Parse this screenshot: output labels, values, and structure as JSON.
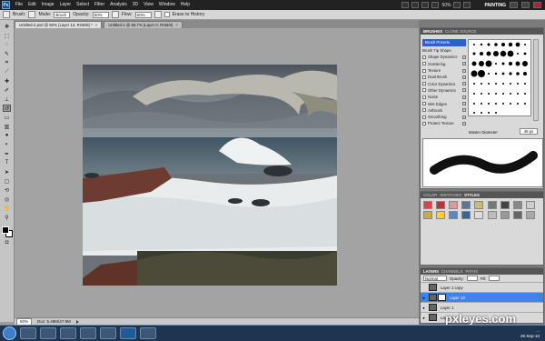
{
  "app": {
    "logo": "Ps",
    "workspace": "PAINTING",
    "zoom": "50%"
  },
  "menu": [
    "File",
    "Edit",
    "Image",
    "Layer",
    "Select",
    "Filter",
    "Analysis",
    "3D",
    "View",
    "Window",
    "Help"
  ],
  "options": {
    "brush_label": "Brush:",
    "mode_label": "Mode:",
    "mode_value": "Brush",
    "opacity_label": "Opacity:",
    "opacity_value": "50%",
    "flow_label": "Flow:",
    "flow_value": "60%",
    "erase_history": "Erase to History"
  },
  "tabs": [
    {
      "title": "Untitled-2.psd @ 50% (Layer 13, RGB/8) *",
      "close": "×"
    },
    {
      "title": "Untitled-1 @ 66.7% (Layer 0, RGB/8)",
      "close": "×"
    }
  ],
  "status": {
    "zoom": "50%",
    "doc": "Doc: 5.49M/47.9M"
  },
  "brushes": {
    "tabs": [
      "BRUSHES",
      "CLONE SOURCE"
    ],
    "preset_label": "Brush Presets",
    "options": [
      "Brush Tip Shape",
      "Shape Dynamics",
      "Scattering",
      "Texture",
      "Dual Brush",
      "Color Dynamics",
      "Other Dynamics",
      "Noise",
      "Wet Edges",
      "Airbrush",
      "Smoothing",
      "Protect Texture"
    ],
    "diameter_label": "Master Diameter",
    "diameter_value": "45 px"
  },
  "styles_tabs": [
    "COLOR",
    "SWATCHES",
    "STYLES"
  ],
  "style_colors": [
    "#d44",
    "#b33",
    "#d99",
    "#579",
    "#cb7",
    "#777",
    "#444",
    "#888",
    "#ccc",
    "#ca4",
    "#fc3",
    "#58c",
    "#369",
    "#ddd",
    "#bbb",
    "#999",
    "#666",
    "#aaa"
  ],
  "layers": {
    "tabs": [
      "LAYERS",
      "CHANNELS",
      "PATHS"
    ],
    "blend_mode": "Normal",
    "opacity_label": "Opacity:",
    "fill_label": "Fill:",
    "rows": [
      {
        "name": "Layer 1 copy",
        "visible": false,
        "active": false
      },
      {
        "name": "Layer 13",
        "visible": true,
        "active": true
      },
      {
        "name": "Layer 1",
        "visible": true,
        "active": false
      },
      {
        "name": "Layer 0",
        "visible": true,
        "active": false
      }
    ]
  },
  "watermark": "pxleyes.com",
  "tray": {
    "time": "...",
    "date": "26-Sep-10"
  }
}
